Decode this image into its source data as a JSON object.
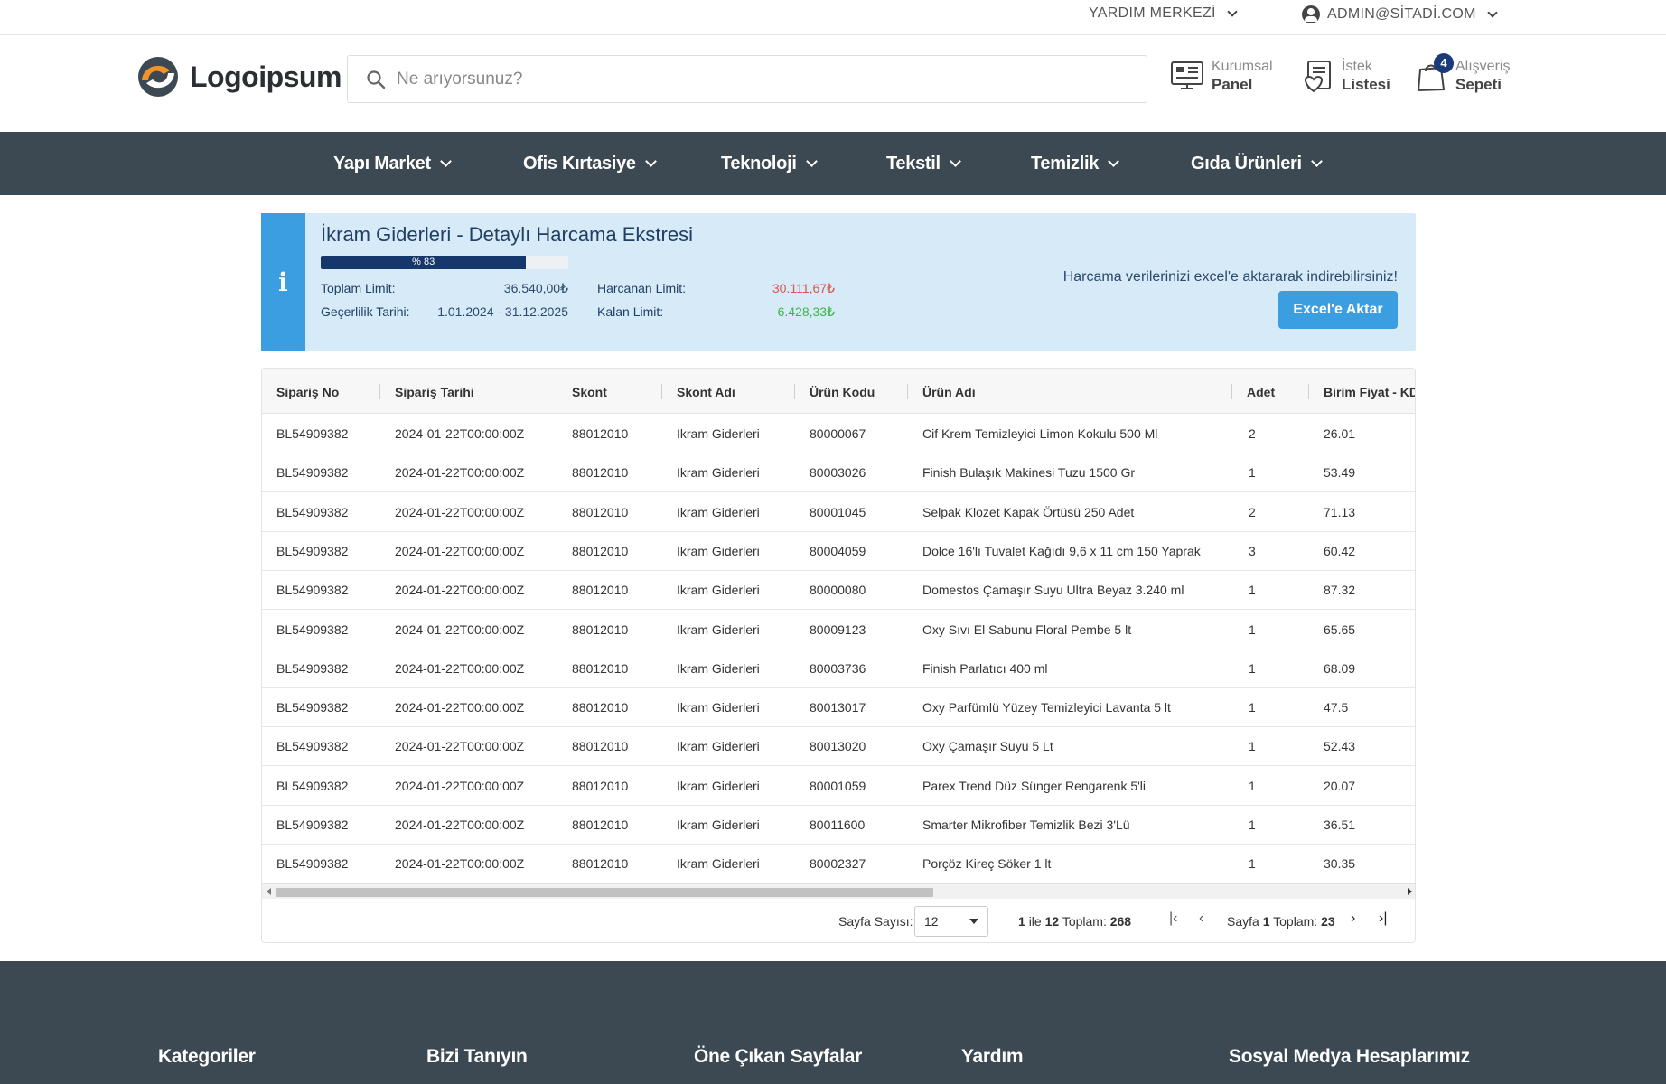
{
  "topbar": {
    "help": "YARDIM MERKEZİ",
    "user": "ADMIN@SİTADİ.COM"
  },
  "header": {
    "logo_text": "Logoipsum",
    "search_placeholder": "Ne arıyorsunuz?",
    "panel": {
      "line1": "Kurumsal",
      "line2": "Panel"
    },
    "wishlist": {
      "line1": "İstek",
      "line2": "Listesi"
    },
    "cart": {
      "line1": "Alışveriş",
      "line2": "Sepeti",
      "badge": "4"
    }
  },
  "nav": [
    "Yapı Market",
    "Ofis Kırtasiye",
    "Teknoloji",
    "Tekstil",
    "Temizlik",
    "Gıda Ürünleri"
  ],
  "info": {
    "icon": "i",
    "title": "İkram Giderleri - Detaylı Harcama Ekstresi",
    "progress_label": "% 83",
    "progress_value": 83,
    "total_label": "Toplam Limit:",
    "total_value": "36.540,00₺",
    "validity_label": "Geçerlilik Tarihi:",
    "validity_value": "1.01.2024 - 31.12.2025",
    "spent_label": "Harcanan Limit:",
    "spent_value": "30.111,67₺",
    "remaining_label": "Kalan Limit:",
    "remaining_value": "6.428,33₺",
    "note": "Harcama verilerinizi excel'e aktararak indirebilirsiniz!",
    "excel_button": "Excel'e Aktar",
    "colors": {
      "spent": "#e0524f",
      "remaining": "#3bb54a"
    }
  },
  "table": {
    "columns": [
      "Sipariş No",
      "Sipariş Tarihi",
      "Skont",
      "Skont Adı",
      "Ürün Kodu",
      "Ürün Adı",
      "Adet",
      "Birim Fiyat - KD"
    ],
    "rows": [
      [
        "BL54909382",
        "2024-01-22T00:00:00Z",
        "88012010",
        "Ikram Giderleri",
        "80000067",
        "Cif Krem Temizleyici Limon Kokulu 500 Ml",
        "2",
        "26.01"
      ],
      [
        "BL54909382",
        "2024-01-22T00:00:00Z",
        "88012010",
        "Ikram Giderleri",
        "80003026",
        "Finish Bulaşık Makinesi Tuzu 1500 Gr",
        "1",
        "53.49"
      ],
      [
        "BL54909382",
        "2024-01-22T00:00:00Z",
        "88012010",
        "Ikram Giderleri",
        "80001045",
        "Selpak Klozet Kapak Örtüsü 250 Adet",
        "2",
        "71.13"
      ],
      [
        "BL54909382",
        "2024-01-22T00:00:00Z",
        "88012010",
        "Ikram Giderleri",
        "80004059",
        "Dolce 16'lı Tuvalet Kağıdı 9,6 x 11 cm 150 Yaprak",
        "3",
        "60.42"
      ],
      [
        "BL54909382",
        "2024-01-22T00:00:00Z",
        "88012010",
        "Ikram Giderleri",
        "80000080",
        "Domestos Çamaşır Suyu Ultra Beyaz 3.240 ml",
        "1",
        "87.32"
      ],
      [
        "BL54909382",
        "2024-01-22T00:00:00Z",
        "88012010",
        "Ikram Giderleri",
        "80009123",
        "Oxy Sıvı El Sabunu Floral Pembe 5 lt",
        "1",
        "65.65"
      ],
      [
        "BL54909382",
        "2024-01-22T00:00:00Z",
        "88012010",
        "Ikram Giderleri",
        "80003736",
        "Finish Parlatıcı 400 ml",
        "1",
        "68.09"
      ],
      [
        "BL54909382",
        "2024-01-22T00:00:00Z",
        "88012010",
        "Ikram Giderleri",
        "80013017",
        "Oxy Parfümlü Yüzey Temizleyici Lavanta 5 lt",
        "1",
        "47.5"
      ],
      [
        "BL54909382",
        "2024-01-22T00:00:00Z",
        "88012010",
        "Ikram Giderleri",
        "80013020",
        "Oxy Çamaşır Suyu 5 Lt",
        "1",
        "52.43"
      ],
      [
        "BL54909382",
        "2024-01-22T00:00:00Z",
        "88012010",
        "Ikram Giderleri",
        "80001059",
        "Parex Trend Düz Sünger Rengarenk 5'li",
        "1",
        "20.07"
      ],
      [
        "BL54909382",
        "2024-01-22T00:00:00Z",
        "88012010",
        "Ikram Giderleri",
        "80011600",
        "Smarter Mikrofiber Temizlik Bezi 3'Lü",
        "1",
        "36.51"
      ],
      [
        "BL54909382",
        "2024-01-22T00:00:00Z",
        "88012010",
        "Ikram Giderleri",
        "80002327",
        "Porçöz Kireç Söker 1 lt",
        "1",
        "30.35"
      ]
    ]
  },
  "pager": {
    "page_size_label": "Sayfa Sayısı:",
    "page_size": "12",
    "range_from": "1",
    "range_word": "ile",
    "range_to": "12",
    "total_word": "Toplam:",
    "total_items": "268",
    "page_word": "Sayfa",
    "page_current": "1",
    "page_total": "23"
  },
  "footer": [
    "Kategoriler",
    "Bizi Tanıyın",
    "Öne Çıkan Sayfalar",
    "Yardım",
    "Sosyal Medya Hesaplarımız"
  ]
}
